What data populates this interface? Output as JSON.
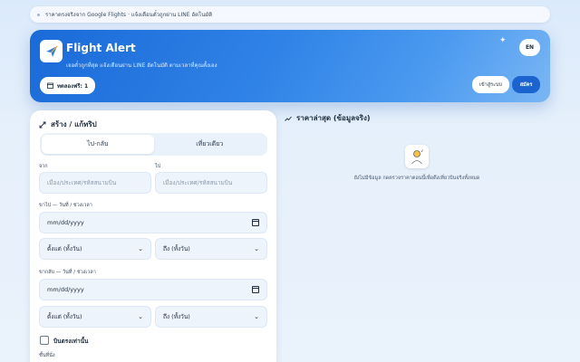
{
  "topbar": {
    "text": "ราคาตรงจริงจาก Google Flights · แจ้งเตือนตั๋วถูกผ่าน LINE อัตโนมัติ"
  },
  "hero": {
    "title": "Flight Alert",
    "subtitle": "เจอตั๋วถูกที่สุด แจ้งเตือนผ่าน LINE อัตโนมัติ ตามเวลาที่คุณตั้งเอง",
    "trial_label": "ทดลองฟรี: 1",
    "lang_button": "EN",
    "login_button": "เข้าสู่ระบบ",
    "signup_button": "สมัคร"
  },
  "form": {
    "title": "สร้าง / แก้ทริป",
    "tabs": [
      {
        "label": "ไป-กลับ",
        "active": true
      },
      {
        "label": "เที่ยวเดียว",
        "active": false
      }
    ],
    "from_label": "จาก",
    "from_placeholder": "เมือง/ประเทศ/รหัสสนามบิน",
    "to_label": "ไป",
    "to_placeholder": "เมือง/ประเทศ/รหัสสนามบิน",
    "depart_label": "ขาไป — วันที่ / ช่วงเวลา",
    "depart_date": "mm/dd/yyyy",
    "depart_from_time": "ตั้งแต่ (ทั้งวัน)",
    "depart_to_time": "ถึง (ทั้งวัน)",
    "return_label": "ขากลับ — วันที่ / ช่วงเวลา",
    "return_date": "mm/dd/yyyy",
    "return_from_time": "ตั้งแต่ (ทั้งวัน)",
    "return_to_time": "ถึง (ทั้งวัน)",
    "direct_only_label": "บินตรงเท่านั้น",
    "bottom_label": "ชั้นที่นั่ง"
  },
  "prices": {
    "title": "ราคาล่าสุด (ข้อมูลจริง)",
    "empty_text": "ยังไม่มีข้อมูล กดตรวจราคาตอนนี้เพื่อดึงเที่ยวบินจริงทั้งหมด"
  },
  "colors": {
    "accent": "#1b64cf",
    "hero_start": "#1a6ad8",
    "hero_end": "#7ab6f4"
  }
}
